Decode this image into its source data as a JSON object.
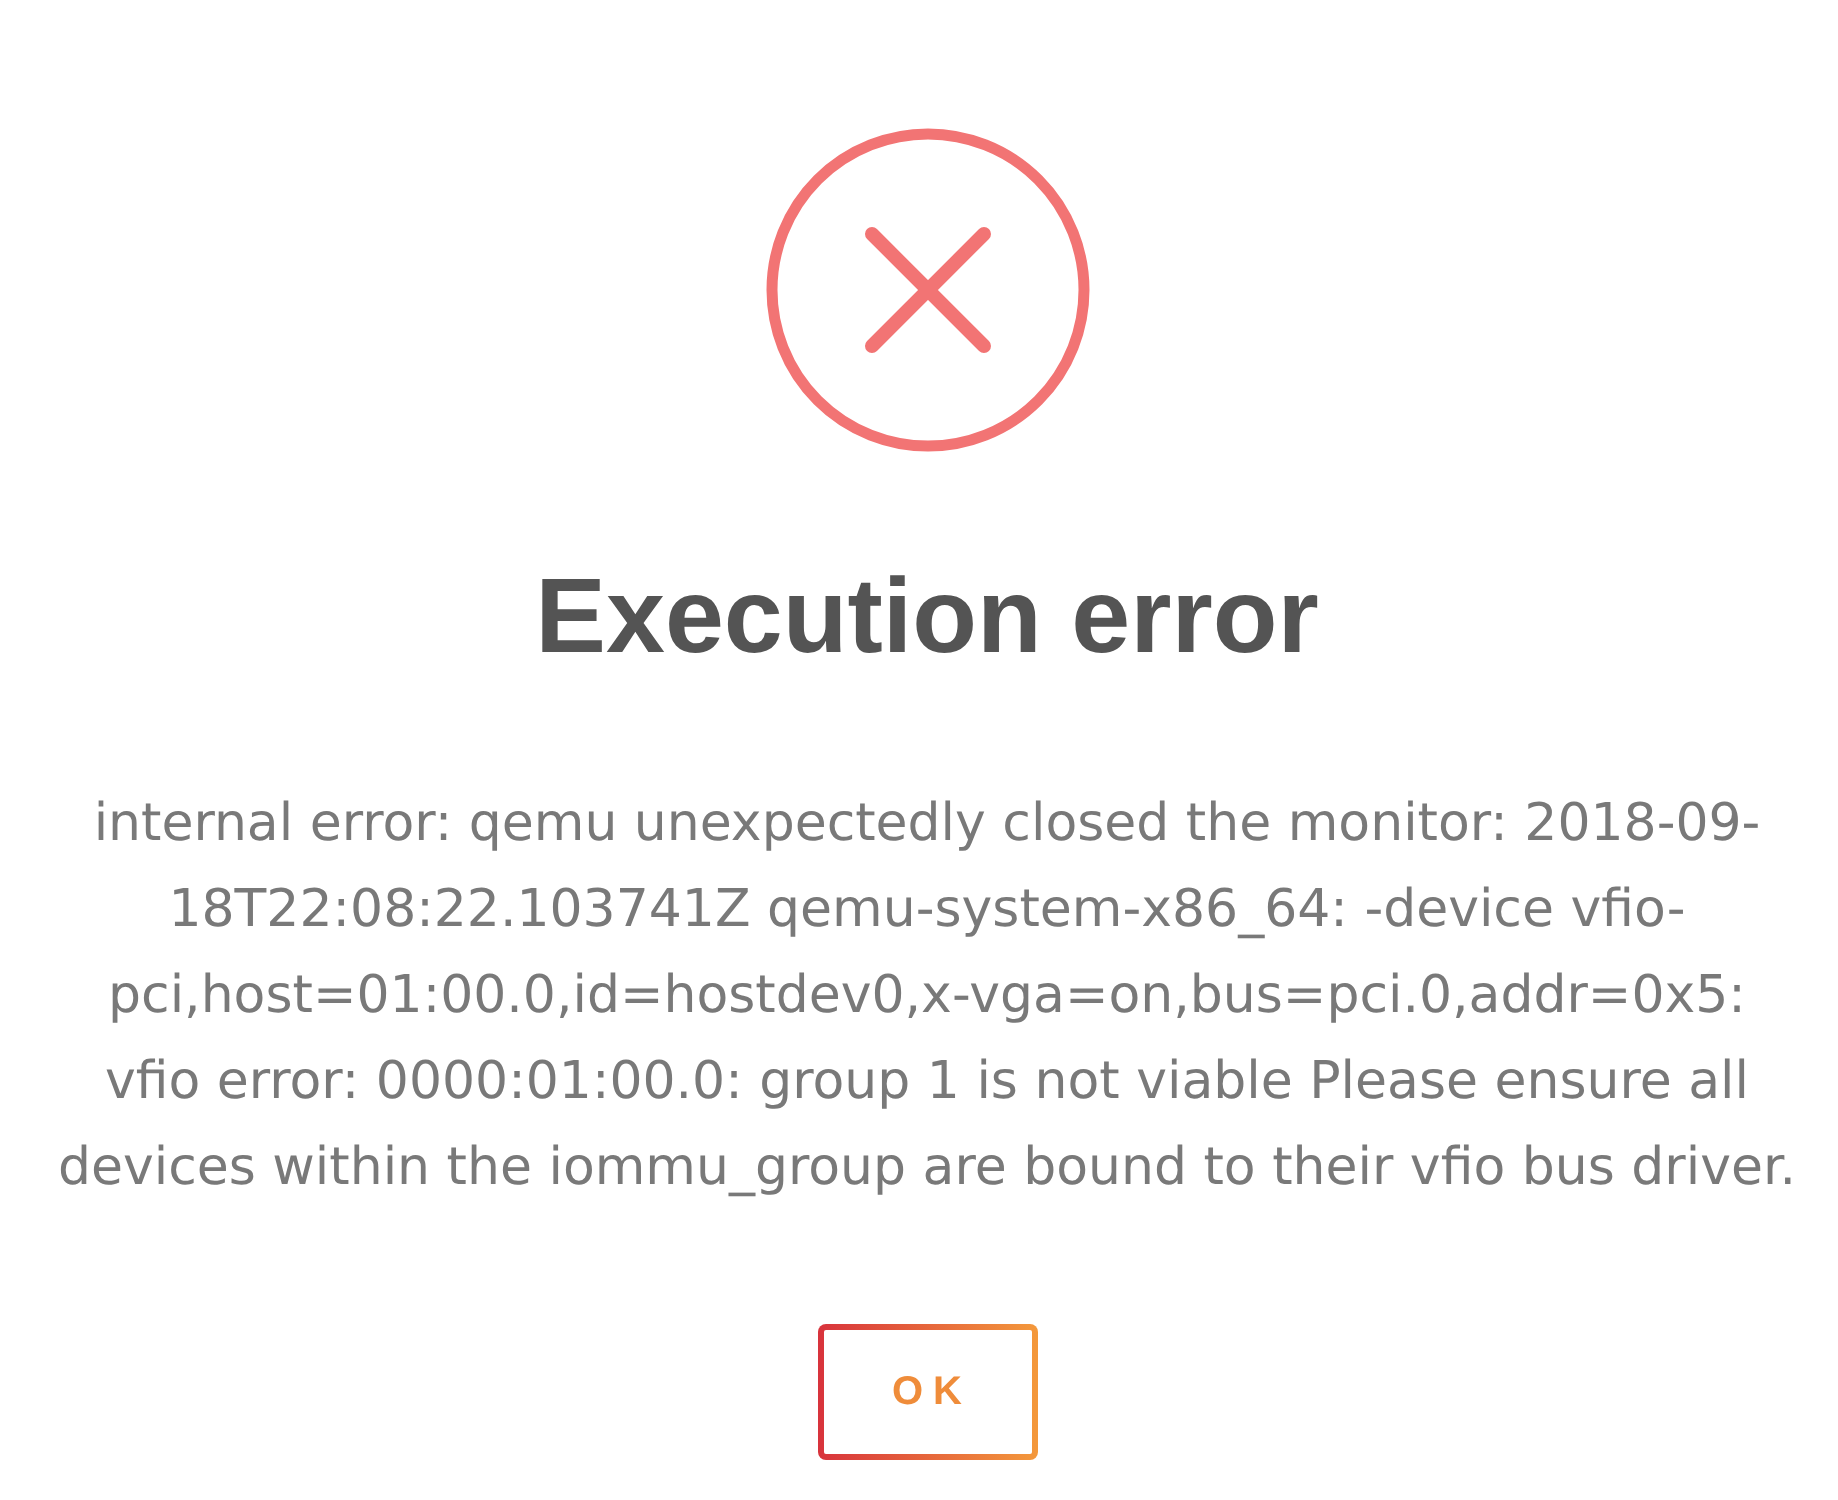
{
  "dialog": {
    "icon": {
      "kind": "error"
    },
    "title": "Execution error",
    "message": "internal error: qemu unexpectedly closed the monitor: 2018-09-18T22:08:22.103741Z qemu-system-x86_64: -device vfio-pci,host=01:00.0,id=hostdev0,x-vga=on,bus=pci.0,addr=0x5: vfio error: 0000:01:00.0: group 1 is not viable Please ensure all devices within the iommu_group are bound to their vfio bus driver.",
    "confirm_button": {
      "label": "OK"
    }
  }
}
